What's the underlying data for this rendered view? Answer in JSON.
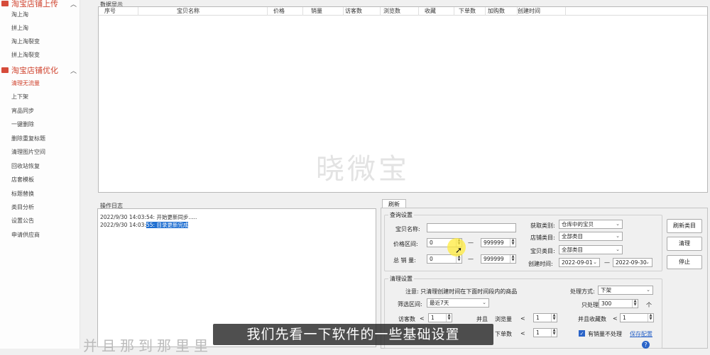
{
  "sidebar": {
    "section1": {
      "title": "淘宝店铺上传"
    },
    "items1": [
      "淘上淘",
      "拼上淘",
      "淘上淘裂变",
      "拼上淘裂变"
    ],
    "section2": {
      "title": "淘宝店铺优化"
    },
    "items2": [
      "清理无流量",
      "上下架",
      "宵品同步",
      "一键删除",
      "删除重复标题",
      "清理图片空间",
      "回收站恢复",
      "店套模板",
      "标题替换",
      "类目分析",
      "设置公告",
      "申请供应商"
    ]
  },
  "data_display": {
    "title": "数据显示",
    "columns": [
      "序号",
      "宝贝名称",
      "价格",
      "销量",
      "访客数",
      "浏览数",
      "收藏",
      "下单数",
      "加购数",
      "创建时间"
    ],
    "watermark": "晓微宝"
  },
  "op_log": {
    "title": "操作日志",
    "lines": [
      {
        "time": "2022/9/30 14:03:54:",
        "text": " 开始更新同步....."
      },
      {
        "time": "2022/9/30 14:03:",
        "text": "55: 目录更新完成"
      }
    ]
  },
  "right": {
    "tab": "刷新",
    "query": {
      "title": "查询设置",
      "name_label": "宝贝名称:",
      "name_value": "",
      "price_label": "价格区间:",
      "price_min": "0",
      "price_max": "999999",
      "sales_label": "总 销 量:",
      "sales_min": "0",
      "sales_max": "999999",
      "dash": "—",
      "fetch_label": "获取类别:",
      "fetch_value": "仓库中的宝贝",
      "store_cat_label": "店铺类目:",
      "store_cat_value": "全部类目",
      "item_cat_label": "宝贝类目:",
      "item_cat_value": "全部类目",
      "created_label": "创建时间:",
      "created_from": "2022-09-01",
      "created_to": "2022-09-30"
    },
    "buttons": {
      "refresh_cat": "刷新类目",
      "clean": "清理",
      "stop": "停止"
    },
    "cleanup": {
      "title": "清理设置",
      "note": "注意: 只清理创建时间在下面时间段内的商品",
      "filter_label": "筛选区间:",
      "filter_value": "最近7天",
      "method_label": "处理方式:",
      "method_value": "下架",
      "only_label": "只处理",
      "only_value": "300",
      "only_unit": "个",
      "visitors_label": "访客数",
      "lt": "<",
      "visitors_value": "1",
      "and": "并且",
      "views_label": "浏览量",
      "views_value": "1",
      "fav_label": "并且收藏数",
      "fav_value": "1",
      "orders_label": "下单数",
      "orders_value": "1",
      "skip_sales_label": "有销量不处理",
      "save_link": "保存配置"
    }
  },
  "caption": "我们先看一下软件的一些基础设置",
  "ghost_caption": "并且那到那里里"
}
